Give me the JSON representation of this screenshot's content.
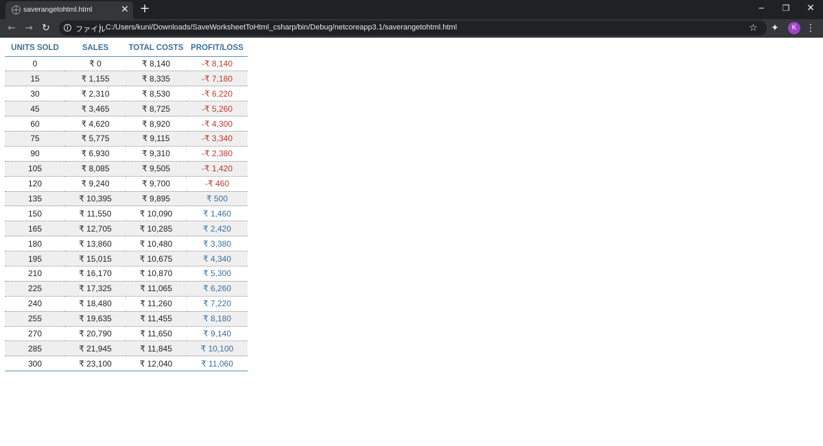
{
  "browser": {
    "tab_title": "saverangetohtml.html",
    "scheme_label": "ファイル",
    "url": "C:/Users/kuni/Downloads/SaveWorksheetToHtml_csharp/bin/Debug/netcoreapp3.1/saverangetohtml.html",
    "avatar_initial": "K"
  },
  "table": {
    "headers": [
      "UNITS SOLD",
      "SALES",
      "TOTAL COSTS",
      "PROFIT/LOSS"
    ],
    "rows": [
      [
        "0",
        "₹ 0",
        "₹ 8,140",
        "-₹ 8,140"
      ],
      [
        "15",
        "₹ 1,155",
        "₹ 8,335",
        "-₹ 7,180"
      ],
      [
        "30",
        "₹ 2,310",
        "₹ 8,530",
        "-₹ 6,220"
      ],
      [
        "45",
        "₹ 3,465",
        "₹ 8,725",
        "-₹ 5,260"
      ],
      [
        "60",
        "₹ 4,620",
        "₹ 8,920",
        "-₹ 4,300"
      ],
      [
        "75",
        "₹ 5,775",
        "₹ 9,115",
        "-₹ 3,340"
      ],
      [
        "90",
        "₹ 6,930",
        "₹ 9,310",
        "-₹ 2,380"
      ],
      [
        "105",
        "₹ 8,085",
        "₹ 9,505",
        "-₹ 1,420"
      ],
      [
        "120",
        "₹ 9,240",
        "₹ 9,700",
        "-₹ 460"
      ],
      [
        "135",
        "₹ 10,395",
        "₹ 9,895",
        "₹ 500"
      ],
      [
        "150",
        "₹ 11,550",
        "₹ 10,090",
        "₹ 1,460"
      ],
      [
        "165",
        "₹ 12,705",
        "₹ 10,285",
        "₹ 2,420"
      ],
      [
        "180",
        "₹ 13,860",
        "₹ 10,480",
        "₹ 3,380"
      ],
      [
        "195",
        "₹ 15,015",
        "₹ 10,675",
        "₹ 4,340"
      ],
      [
        "210",
        "₹ 16,170",
        "₹ 10,870",
        "₹ 5,300"
      ],
      [
        "225",
        "₹ 17,325",
        "₹ 11,065",
        "₹ 6,260"
      ],
      [
        "240",
        "₹ 18,480",
        "₹ 11,260",
        "₹ 7,220"
      ],
      [
        "255",
        "₹ 19,635",
        "₹ 11,455",
        "₹ 8,180"
      ],
      [
        "270",
        "₹ 20,790",
        "₹ 11,650",
        "₹ 9,140"
      ],
      [
        "285",
        "₹ 21,945",
        "₹ 11,845",
        "₹ 10,100"
      ],
      [
        "300",
        "₹ 23,100",
        "₹ 12,040",
        "₹ 11,060"
      ]
    ]
  },
  "colors": {
    "header_text": "#3a6f9b",
    "loss_text": "#c0392b",
    "profit_text": "#3a6f9b",
    "stripe": "#efefef"
  },
  "icons": {
    "tab_favicon": "globe-icon",
    "tab_close": "close-icon",
    "new_tab": "plus-icon",
    "back": "arrow-left-icon",
    "forward": "arrow-right-icon",
    "reload": "reload-icon",
    "site_info": "info-icon",
    "bookmark": "star-icon",
    "extensions": "puzzle-icon",
    "menu": "kebab-menu-icon"
  }
}
